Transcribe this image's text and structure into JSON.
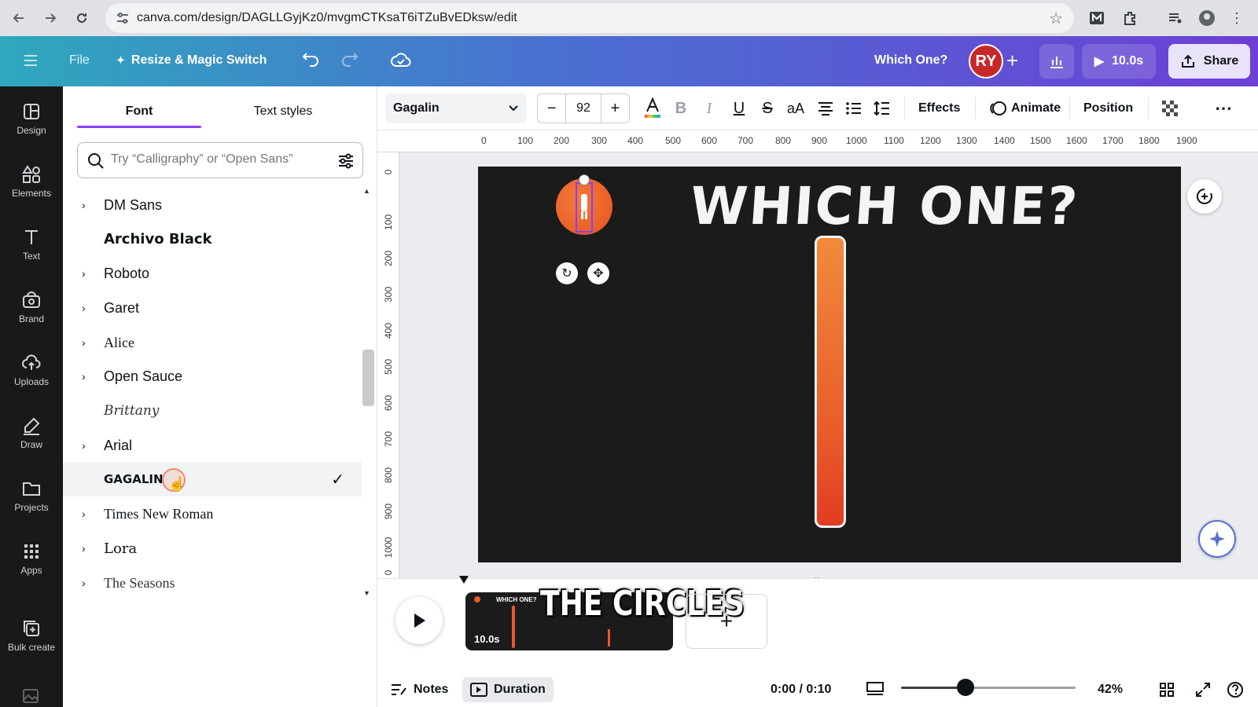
{
  "browser": {
    "url": "canva.com/design/DAGLLGyjKz0/mvgmCTKsaT6iTZuBvEDksw/edit"
  },
  "header": {
    "file_label": "File",
    "resize_label": "Resize & Magic Switch",
    "design_title": "Which One?",
    "avatar_initials": "RY",
    "play_duration": "10.0s",
    "share_label": "Share"
  },
  "rail": {
    "items": [
      {
        "label": "Design",
        "icon": "design-icon"
      },
      {
        "label": "Elements",
        "icon": "elements-icon"
      },
      {
        "label": "Text",
        "icon": "text-icon"
      },
      {
        "label": "Brand",
        "icon": "brand-icon"
      },
      {
        "label": "Uploads",
        "icon": "uploads-icon"
      },
      {
        "label": "Draw",
        "icon": "draw-icon"
      },
      {
        "label": "Projects",
        "icon": "projects-icon"
      },
      {
        "label": "Apps",
        "icon": "apps-icon"
      },
      {
        "label": "Bulk create",
        "icon": "bulk-create-icon"
      }
    ]
  },
  "panel": {
    "tabs": [
      {
        "label": "Font"
      },
      {
        "label": "Text styles"
      }
    ],
    "search_placeholder": "Try “Calligraphy” or “Open Sans”",
    "fonts": [
      {
        "name": "DM Sans",
        "expandable": true
      },
      {
        "name": "Archivo Black",
        "expandable": false
      },
      {
        "name": "Roboto",
        "expandable": true
      },
      {
        "name": "Garet",
        "expandable": true
      },
      {
        "name": "Alice",
        "expandable": true
      },
      {
        "name": "Open Sauce",
        "expandable": true
      },
      {
        "name": "Brittany",
        "expandable": false
      },
      {
        "name": "Arial",
        "expandable": true
      },
      {
        "name": "GAGALIN",
        "expandable": false,
        "selected": true
      },
      {
        "name": "Times New Roman",
        "expandable": true
      },
      {
        "name": "Lora",
        "expandable": true
      },
      {
        "name": "The Seasons",
        "expandable": true
      }
    ]
  },
  "toolbar": {
    "font_family": "Gagalin",
    "font_size": "92",
    "effects_label": "Effects",
    "animate_label": "Animate",
    "position_label": "Position"
  },
  "ruler": {
    "top_labels": [
      "0",
      "100",
      "200",
      "300",
      "400",
      "500",
      "600",
      "700",
      "800",
      "900",
      "1000",
      "1100",
      "1200",
      "1300",
      "1400",
      "1500",
      "1600",
      "1700",
      "1800",
      "1900"
    ],
    "left_labels": [
      "0",
      "100",
      "200",
      "300",
      "400",
      "500",
      "600",
      "700",
      "800",
      "900",
      "1000",
      "0"
    ]
  },
  "canvas": {
    "title": "WHICH ONE?"
  },
  "timeline": {
    "clip_title": "WHICH ONE?",
    "clip_duration": "10.0s",
    "caption": "THE CIRCLES"
  },
  "bottom": {
    "notes_label": "Notes",
    "duration_label": "Duration",
    "time_readout": "0:00 / 0:10",
    "zoom_level": "42%",
    "zoom_fraction": 0.37
  },
  "colors": {
    "accent": "#8b3dff",
    "canvas_bg": "#1b1b1b",
    "thermo_orange": "#e85a2a"
  }
}
